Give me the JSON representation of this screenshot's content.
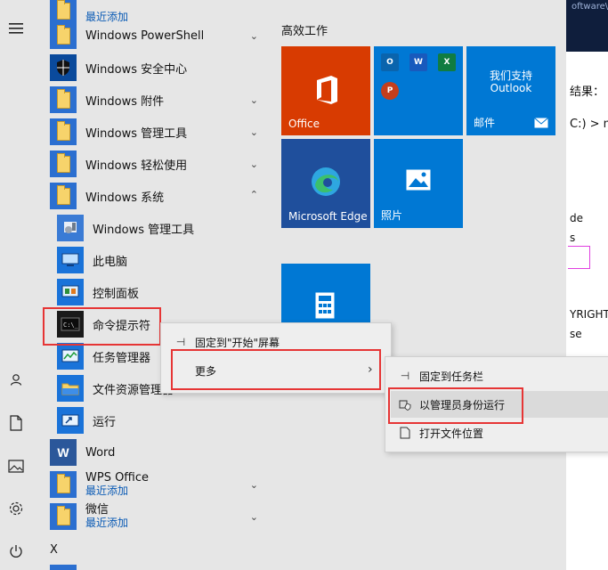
{
  "background_app": {
    "title_fragment": "oftware\\",
    "texts": [
      "结果：",
      "C:) > m",
      "de",
      "s",
      "YRIGHT",
      "se"
    ]
  },
  "rail": [
    "hamburger-menu-icon",
    "user-icon",
    "document-icon",
    "pictures-icon",
    "settings-icon",
    "power-icon"
  ],
  "app_list": {
    "top_partial": {
      "name": "",
      "sub": "最近添加"
    },
    "items": [
      {
        "label": "Windows PowerShell"
      },
      {
        "label": "Windows 安全中心"
      },
      {
        "label": "Windows 附件"
      },
      {
        "label": "Windows 管理工具"
      },
      {
        "label": "Windows 轻松使用"
      },
      {
        "label": "Windows 系统"
      }
    ],
    "system_items": [
      {
        "label": "Windows 管理工具"
      },
      {
        "label": "此电脑"
      },
      {
        "label": "控制面板"
      },
      {
        "label": "命令提示符"
      },
      {
        "label": "任务管理器"
      },
      {
        "label": "文件资源管理器"
      },
      {
        "label": "运行"
      }
    ],
    "word": {
      "label": "Word"
    },
    "wps": {
      "name": "WPS Office",
      "sub": "最近添加"
    },
    "wechat": {
      "name": "微信",
      "sub": "最近添加"
    },
    "section_letter": "X"
  },
  "tiles": {
    "group_title": "高效工作",
    "office_label": "Office",
    "mail_line1": "我们支持",
    "mail_line2": "Outlook",
    "mail_label": "邮件",
    "edge_label": "Microsoft Edge",
    "photos_label": "照片"
  },
  "context_menu_1": {
    "pin_start": "固定到\"开始\"屏幕",
    "more": "更多"
  },
  "context_menu_2": {
    "pin_taskbar": "固定到任务栏",
    "run_as_admin": "以管理员身份运行",
    "open_location": "打开文件位置"
  },
  "colors": {
    "highlight": "#e63535",
    "office_tile": "#d83b01",
    "tile_blue": "#0078d4",
    "edge_tile": "#1f4f9c"
  }
}
